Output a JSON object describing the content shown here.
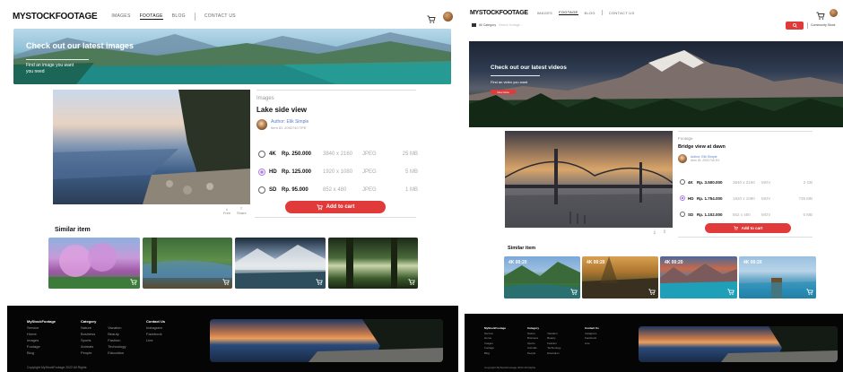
{
  "colors": {
    "accent": "#e03a3a",
    "link": "#5a7fc8",
    "radio_selected": "#b07de8",
    "footer_bg": "#050505"
  },
  "icons": {
    "cart": "cart-icon",
    "avatar": "user-avatar",
    "search": "search-icon",
    "download": "download-icon",
    "share": "share-icon",
    "camera": "camera-icon"
  },
  "left": {
    "logo": "MYSTOCKFOOTAGE",
    "nav": [
      "IMAGES",
      "FOOTAGE",
      "BLOG",
      "CONTACT US"
    ],
    "nav_active_index": 1,
    "banner": {
      "title": "Check out our latest images",
      "sub1": "Find an image you want",
      "sub2": "you need"
    },
    "detail": {
      "category": "Images",
      "title": "Lake side view",
      "author": "Author: Elik Simple",
      "item_id": "Item ID: 2092740 TPE",
      "options": [
        {
          "res": "4K",
          "price": "Rp. 250.000",
          "size": "3840 x 2160",
          "format": "JPEG",
          "file": "25 MB",
          "selected": false
        },
        {
          "res": "HD",
          "price": "Rp. 125.000",
          "size": "1920 x 1080",
          "format": "JPEG",
          "file": "5 MB",
          "selected": true
        },
        {
          "res": "SD",
          "price": "Rp. 95.000",
          "size": "852 x 480",
          "format": "JPEG",
          "file": "1 MB",
          "selected": false
        }
      ],
      "add_to_cart": "Add to cart",
      "icon_labels": [
        "Free",
        "Share"
      ]
    },
    "similar_title": "Similar item",
    "footer": {
      "cols": [
        {
          "head": "MyStockFootage",
          "items": [
            "Service",
            "Home",
            "Images",
            "Footage",
            "Blog"
          ]
        },
        {
          "head": "Category",
          "items": [
            "Nature",
            "Business",
            "Sports",
            "Animals",
            "People"
          ],
          "items2": [
            "Vacation",
            "Beauty",
            "Fashion",
            "Technology",
            "Education"
          ]
        },
        {
          "head": "Contact Us",
          "items": [
            "Instagram",
            "Facebook",
            "Line"
          ]
        }
      ],
      "copyright": "Copyright MyStockFootage 2022 All Rights"
    }
  },
  "right": {
    "logo": "MYSTOCKFOOTAGE",
    "nav": [
      "IMAGES",
      "FOOTAGE",
      "BLOG",
      "CONTACT US"
    ],
    "nav_active_index": 1,
    "search_category": "All Category",
    "search_placeholder": "Search footage...",
    "account_label": "Community Stock",
    "banner": {
      "title": "Check out our latest videos",
      "sub": "Find an video you want"
    },
    "banner_button": "View More",
    "detail": {
      "category": "Footage",
      "title": "Bridge view at dawn",
      "author": "Author: Elik Simple",
      "item_id": "Item ID: 2092740 EX",
      "options": [
        {
          "res": "4K",
          "price": "Rp. 3.500.000",
          "size": "3840 x 2160",
          "format": "MOV",
          "file": "2 GB",
          "selected": false
        },
        {
          "res": "HD",
          "price": "Rp. 1.754.000",
          "size": "1920 x 1080",
          "format": "MOV",
          "file": "735 MB",
          "selected": true
        },
        {
          "res": "SD",
          "price": "Rp. 1.102.000",
          "size": "852 x 480",
          "format": "MOV",
          "file": "5 MB",
          "selected": false
        }
      ],
      "add_to_cart": "Add to cart"
    },
    "similar_title": "Similar item",
    "durations": [
      "4K 00:20",
      "4K 00:20",
      "4K 00:20",
      "4K 00:20"
    ],
    "footer": {
      "cols": [
        {
          "head": "MyStockFootage",
          "items": [
            "Service",
            "Home",
            "Images",
            "Footage",
            "Blog"
          ]
        },
        {
          "head": "Category",
          "items": [
            "Nature",
            "Business",
            "Sports",
            "Animals",
            "People"
          ],
          "items2": [
            "Vacation",
            "Beauty",
            "Fashion",
            "Technology",
            "Education"
          ]
        },
        {
          "head": "Contact Us",
          "items": [
            "Instagram",
            "Facebook",
            "Line"
          ]
        }
      ],
      "copyright": "Copyright MyStockFootage 2022 All Rights"
    }
  }
}
